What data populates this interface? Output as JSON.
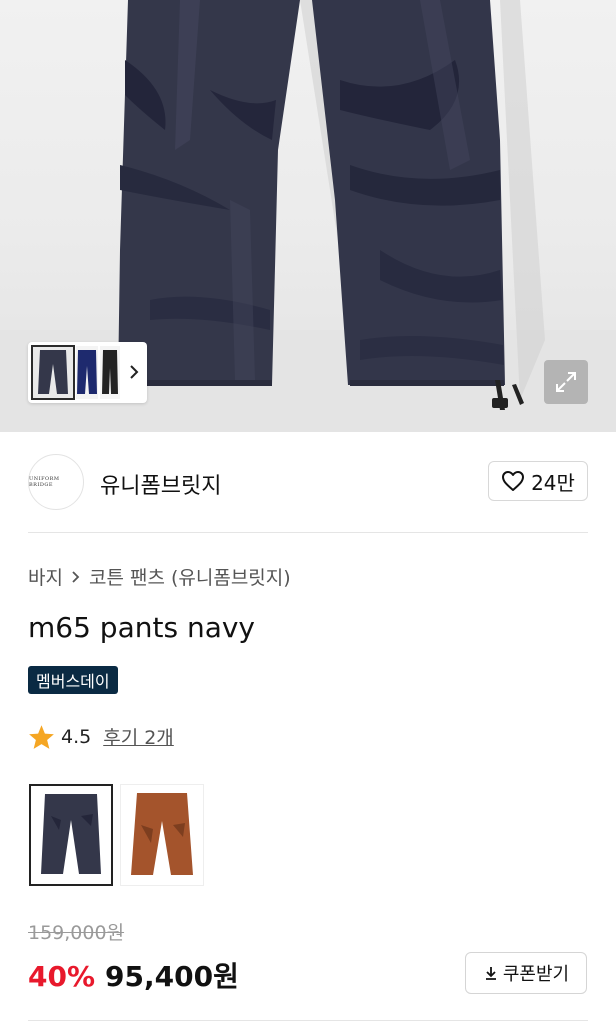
{
  "hero": {
    "thumbnails": [
      "navy-pants-thumb",
      "blue-pants-thumb",
      "black-pants-thumb"
    ],
    "next_icon": "chevron-right-icon",
    "expand_icon": "expand-icon"
  },
  "brand": {
    "logo_text": "UNIFORM BRIDGE",
    "name": "유니폼브릿지",
    "like_icon": "heart-icon",
    "like_count": "24만"
  },
  "breadcrumb": {
    "category": "바지",
    "separator_icon": "chevron-right-icon",
    "subcategory": "코튼 팬츠 (유니폼브릿지)"
  },
  "product": {
    "title": "m65 pants navy",
    "badge": "멤버스데이",
    "rating_icon": "star-icon",
    "rating": "4.5",
    "review_link": "후기 2개"
  },
  "color_options": [
    {
      "name": "navy",
      "selected": true,
      "color": "#34374a"
    },
    {
      "name": "brown",
      "selected": false,
      "color": "#a4542c"
    }
  ],
  "price": {
    "original": "159,000원",
    "discount": "40%",
    "sale": "95,400원"
  },
  "coupon": {
    "icon": "download-icon",
    "label": "쿠폰받기"
  },
  "colors": {
    "accent_red": "#e8192c",
    "badge_navy": "#0a2a43",
    "star": "#f5a623"
  }
}
